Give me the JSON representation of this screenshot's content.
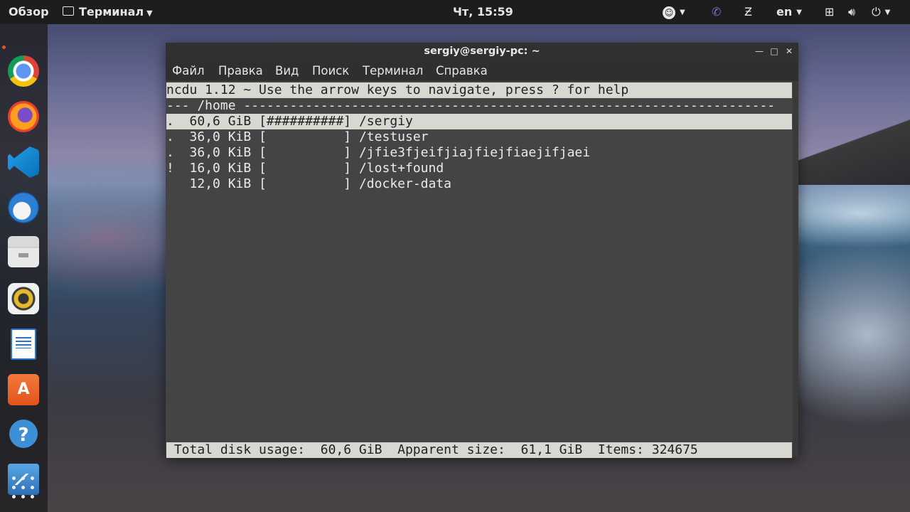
{
  "topbar": {
    "overview": "Обзор",
    "app_name": "Терминал",
    "clock": "Чт, 15:59",
    "lang": "en"
  },
  "window": {
    "title": "sergiy@sergiy-pc: ~",
    "menu": [
      "Файл",
      "Правка",
      "Вид",
      "Поиск",
      "Терминал",
      "Справка"
    ]
  },
  "ncdu": {
    "header": "ncdu 1.12 ~ Use the arrow keys to navigate, press ? for help",
    "path_line": "--- /home ---------------------------------------------------------------------",
    "rows": [
      {
        "flag": ".",
        "size": "60,6 GiB",
        "bar": "[##########]",
        "name": "/sergiy"
      },
      {
        "flag": ".",
        "size": "36,0 KiB",
        "bar": "[          ]",
        "name": "/testuser"
      },
      {
        "flag": ".",
        "size": "36,0 KiB",
        "bar": "[          ]",
        "name": "/jfie3fjeifjiajfiejfiaejifjaei"
      },
      {
        "flag": "!",
        "size": "16,0 KiB",
        "bar": "[          ]",
        "name": "/lost+found"
      },
      {
        "flag": " ",
        "size": "12,0 KiB",
        "bar": "[          ]",
        "name": "/docker-data"
      }
    ],
    "footer": " Total disk usage:  60,6 GiB  Apparent size:  61,1 GiB  Items: 324675"
  },
  "icons": {
    "dock": [
      "chrome-icon",
      "firefox-icon",
      "vscode-icon",
      "thunderbird-icon",
      "files-icon",
      "rhythmbox-icon",
      "writer-icon",
      "software-icon",
      "help-icon",
      "system-monitor-icon",
      "app-grid-icon"
    ]
  }
}
